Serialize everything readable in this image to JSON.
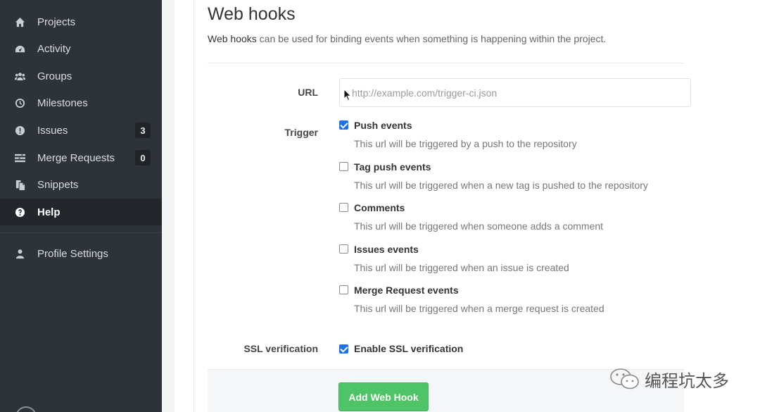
{
  "sidebar": {
    "items": [
      {
        "label": "Projects",
        "icon": "home-icon"
      },
      {
        "label": "Activity",
        "icon": "dashboard-icon"
      },
      {
        "label": "Groups",
        "icon": "group-icon"
      },
      {
        "label": "Milestones",
        "icon": "clock-icon"
      },
      {
        "label": "Issues",
        "icon": "exclamation-circle-icon",
        "badge": "3"
      },
      {
        "label": "Merge Requests",
        "icon": "list-icon",
        "badge": "0"
      },
      {
        "label": "Snippets",
        "icon": "copy-icon"
      },
      {
        "label": "Help",
        "icon": "question-circle-icon",
        "active": true
      },
      {
        "label": "Profile Settings",
        "icon": "user-icon"
      }
    ]
  },
  "main": {
    "title": "Web hooks",
    "description_strong": "Web hooks",
    "description_rest": " can be used for binding events when something is happening within the project."
  },
  "form": {
    "url_label": "URL",
    "url_placeholder": "http://example.com/trigger-ci.json",
    "trigger_label": "Trigger",
    "triggers": [
      {
        "label": "Push events",
        "help": "This url will be triggered by a push to the repository",
        "checked": true
      },
      {
        "label": "Tag push events",
        "help": "This url will be triggered when a new tag is pushed to the repository",
        "checked": false
      },
      {
        "label": "Comments",
        "help": "This url will be triggered when someone adds a comment",
        "checked": false
      },
      {
        "label": "Issues events",
        "help": "This url will be triggered when an issue is created",
        "checked": false
      },
      {
        "label": "Merge Request events",
        "help": "This url will be triggered when a merge request is created",
        "checked": false
      }
    ],
    "ssl_label": "SSL verification",
    "ssl_option_label": "Enable SSL verification",
    "ssl_checked": true,
    "submit_label": "Add Web Hook"
  },
  "watermark": {
    "text": "编程坑太多"
  },
  "colors": {
    "sidebar_bg": "#2e3339",
    "submit_bg": "#4dc466",
    "checkbox_checked": "#1a73e8"
  }
}
